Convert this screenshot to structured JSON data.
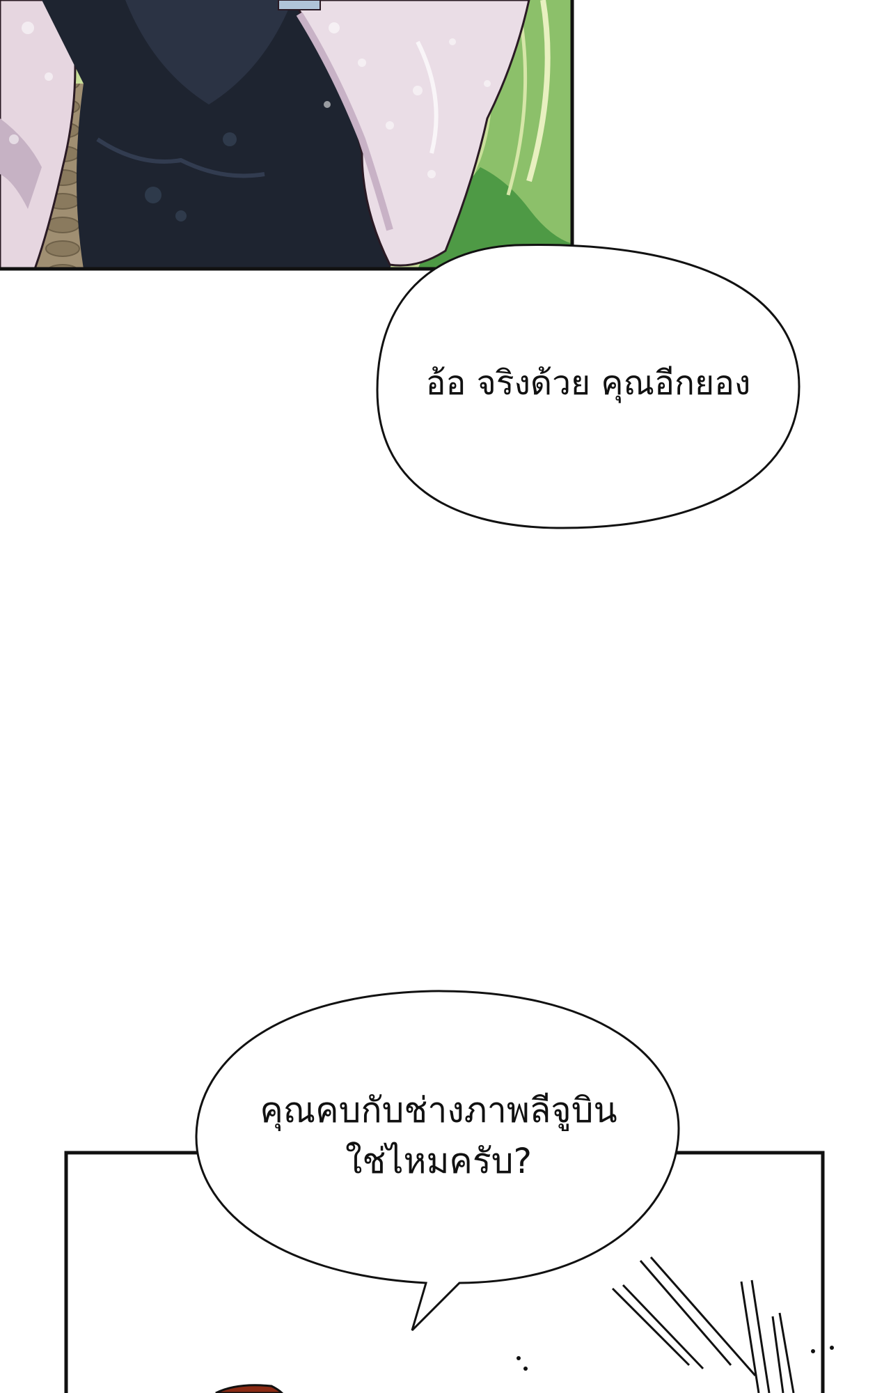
{
  "page": {
    "background": "#ffffff"
  },
  "panels": {
    "top": {
      "scene": "man in dark t-shirt standing outdoors with dappled sunlight, stone path and green bushes",
      "colors": {
        "shirt": "#1e2430",
        "skin": "#e9dde4",
        "path": "#9a8a70",
        "foliage": "#5fa850",
        "grass_bg": "#b8d88a",
        "border": "#111111"
      }
    },
    "bottom": {
      "scene": "white panel with speed lines and a red-brown object edge",
      "colors": {
        "border": "#111111",
        "accent": "#8a2a14"
      }
    }
  },
  "bubbles": [
    {
      "id": "bubble-1",
      "lines": [
        "อ้อ จริงด้วย คุณอีกยอง"
      ]
    },
    {
      "id": "bubble-2",
      "lines": [
        "คุณคบกับช่างภาพลีจูบิน",
        "ใช่ไหมครับ?"
      ]
    }
  ]
}
